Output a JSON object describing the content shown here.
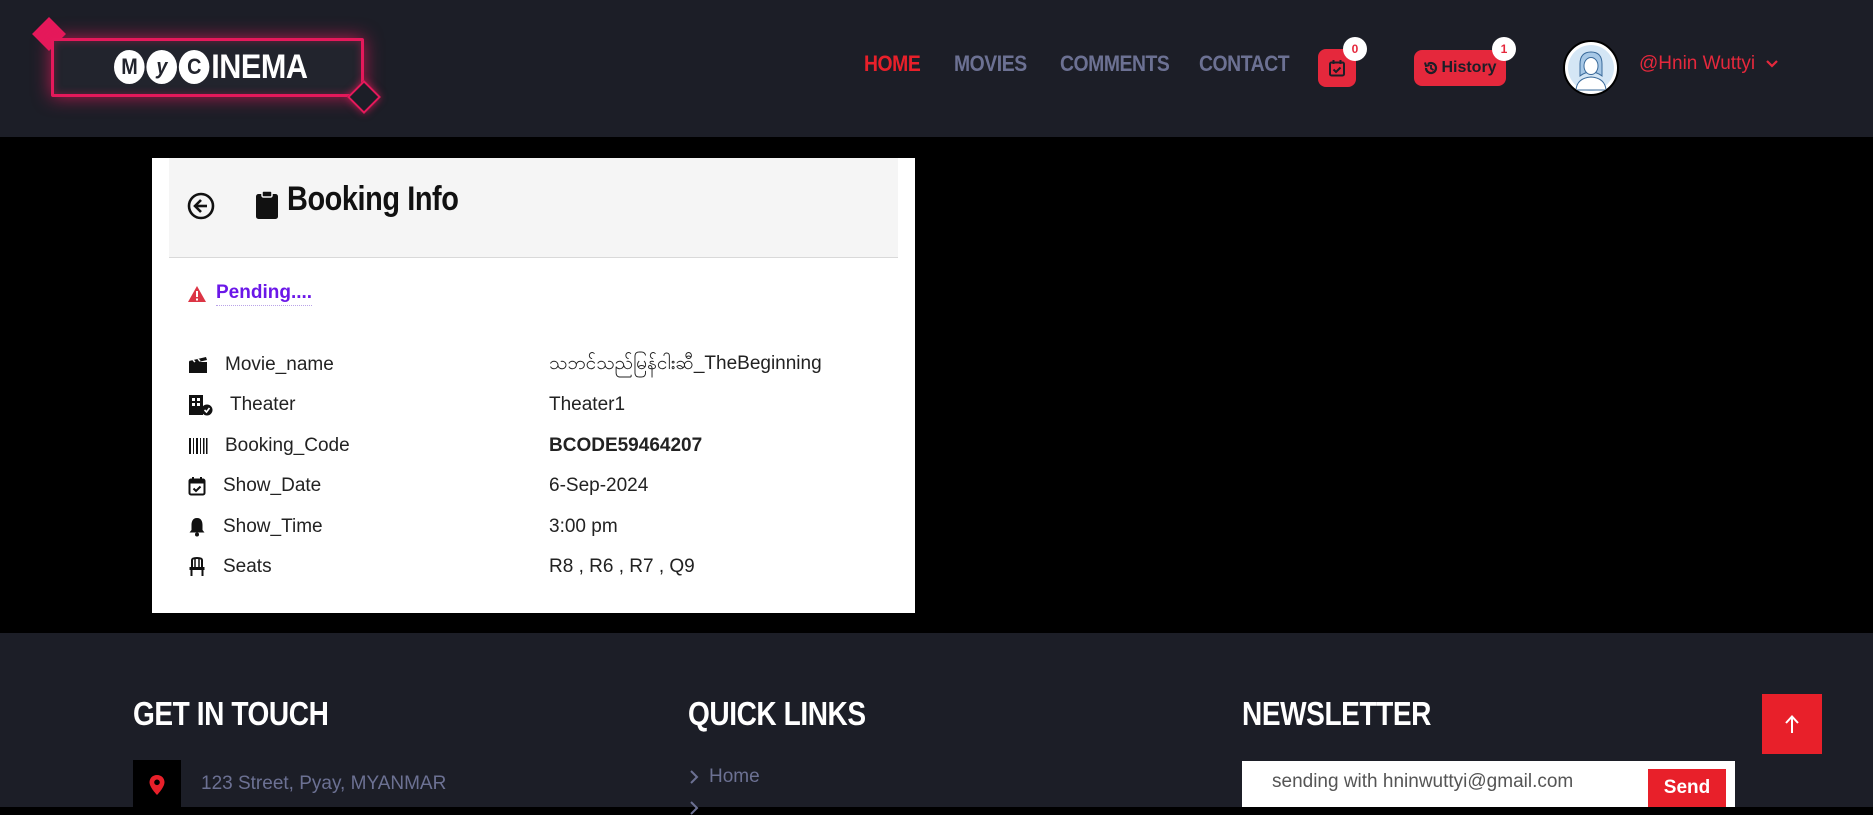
{
  "brand": {
    "logo_text": "INEMA",
    "logo_letters": [
      "M",
      "y",
      "C"
    ]
  },
  "nav": {
    "items": [
      {
        "label": "HOME",
        "active": true
      },
      {
        "label": "MOVIES",
        "active": false
      },
      {
        "label": "COMMENTS",
        "active": false
      },
      {
        "label": "CONTACT",
        "active": false
      }
    ],
    "cart_count": "0",
    "history_label": "History",
    "history_count": "1",
    "username": "@Hnin Wuttyi"
  },
  "booking": {
    "title": "Booking Info",
    "status": "Pending....",
    "rows": [
      {
        "icon": "clapperboard-icon",
        "label": "Movie_name",
        "value": "သဘင်သည်မြန်ငါးဆီ_TheBeginning"
      },
      {
        "icon": "building-check-icon",
        "label": "Theater",
        "value": "Theater1"
      },
      {
        "icon": "barcode-icon",
        "label": "Booking_Code",
        "value": "BCODE59464207"
      },
      {
        "icon": "calendar-check-icon",
        "label": "Show_Date",
        "value": "6-Sep-2024"
      },
      {
        "icon": "bell-icon",
        "label": "Show_Time",
        "value": "3:00 pm"
      },
      {
        "icon": "chair-icon",
        "label": "Seats",
        "value": "R8 , R6 , R7 , Q9"
      }
    ]
  },
  "footer": {
    "get_in_touch": "GET IN TOUCH",
    "address": "123 Street, Pyay, MYANMAR",
    "quick_links": "QUICK LINKS",
    "quick_link_items": [
      "Home"
    ],
    "newsletter": "NEWSLETTER",
    "newsletter_placeholder": "sending with hninwuttyi@gmail.com",
    "send_label": "Send"
  },
  "colors": {
    "accent_red": "#e8202a",
    "pink_neon": "#e5195b",
    "nav_gray": "#6c7193",
    "header_bg": "#1c1e27",
    "status_purple": "#6b17e8"
  }
}
